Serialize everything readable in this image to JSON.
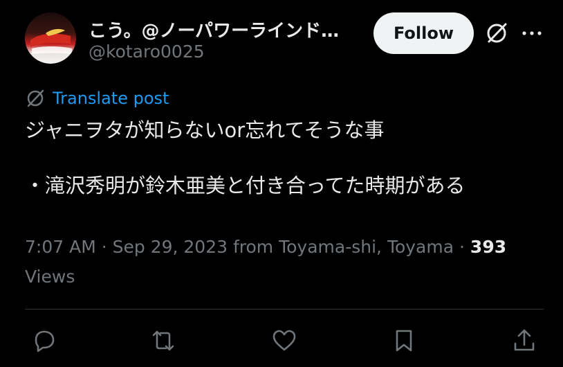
{
  "author": {
    "display_name": "こう。@ノーパワーラインド…",
    "handle": "@kotaro0025"
  },
  "follow_label": "Follow",
  "translate_label": "Translate post",
  "tweet": {
    "line1": "ジャニヲタが知らないor忘れてそうな事",
    "line2": "・滝沢秀明が鈴木亜美と付き合ってた時期がある"
  },
  "meta": {
    "time": "7:07 AM",
    "date": "Sep 29, 2023",
    "location": "from Toyama-shi, Toyama",
    "views_count": "393",
    "views_label": "Views"
  },
  "icons": {
    "grok": "grok-icon",
    "more": "more-icon",
    "reply": "reply-icon",
    "repost": "repost-icon",
    "like": "like-icon",
    "bookmark": "bookmark-icon",
    "share": "share-icon"
  },
  "colors": {
    "background": "#000000",
    "text": "#e7e9ea",
    "secondary": "#71767b",
    "accent": "#1d9bf0",
    "follow_bg": "#eff3f4"
  }
}
